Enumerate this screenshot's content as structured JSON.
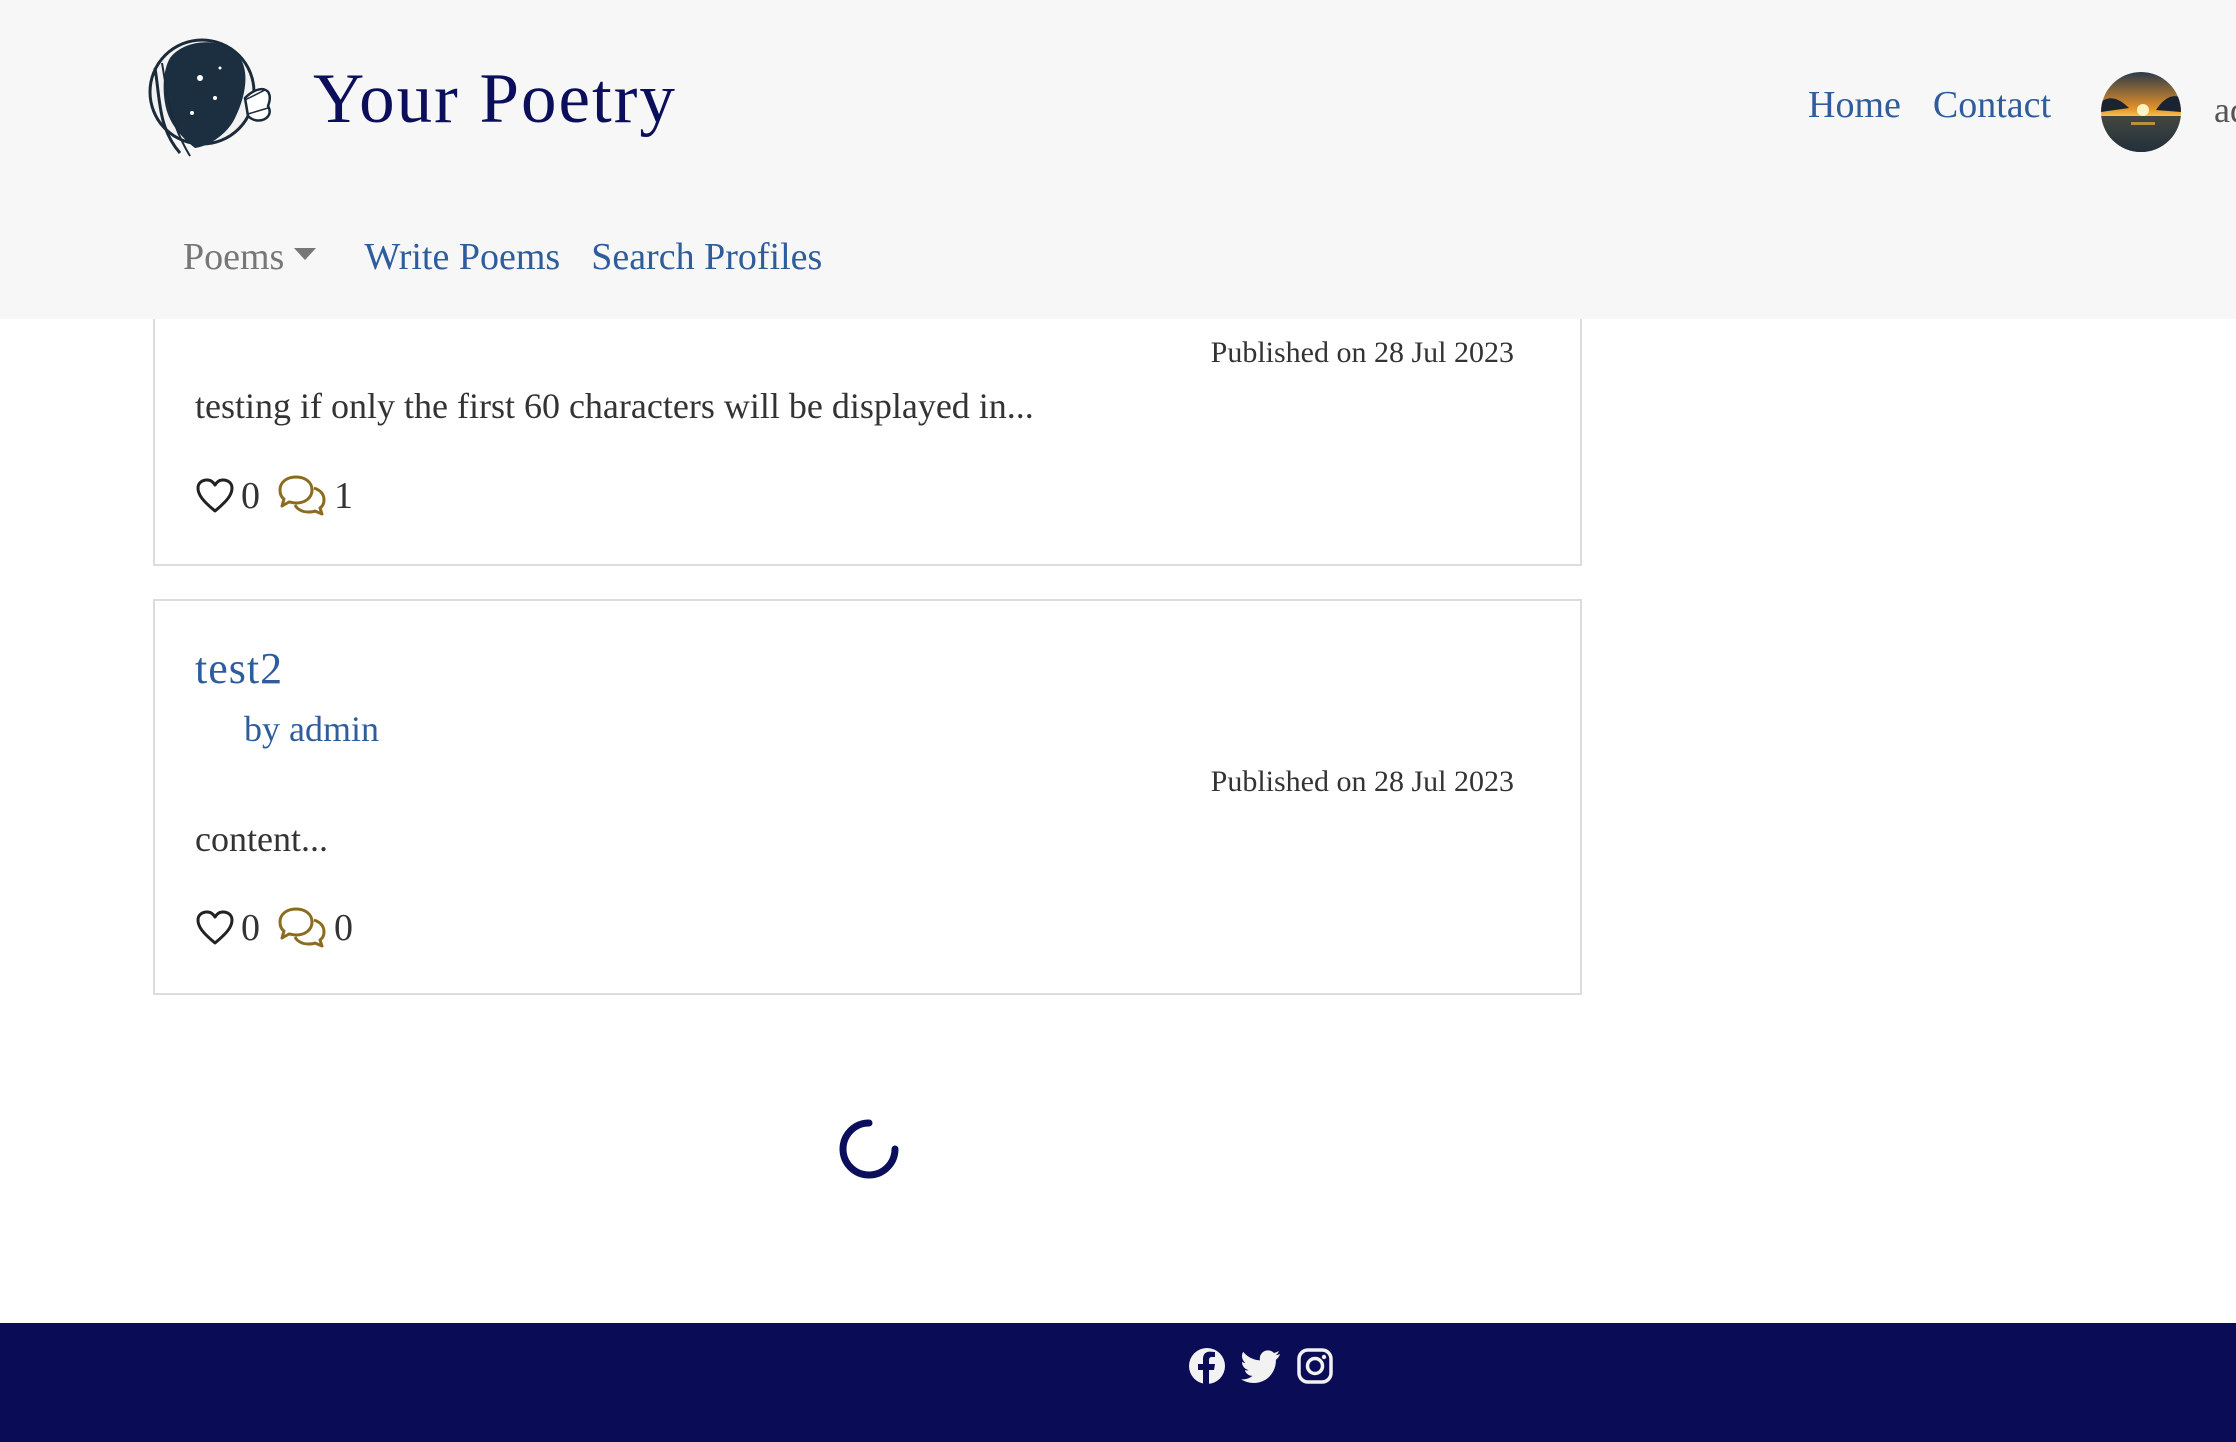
{
  "brand": {
    "name": "Your Poetry",
    "logo_icon": "woman-profile-butterfly-logo"
  },
  "nav": {
    "home": "Home",
    "contact": "Contact",
    "avatar_icon": "sunset-avatar",
    "user_name": "admin"
  },
  "subnav": {
    "poems": "Poems",
    "write": "Write Poems",
    "search": "Search Profiles"
  },
  "poems": [
    {
      "published": "Published on 28 Jul 2023",
      "excerpt": "testing if only the first 60 characters will be displayed in...",
      "likes": "0",
      "comments": "1"
    },
    {
      "title": "test2",
      "author": "by admin",
      "published": "Published on 28 Jul 2023",
      "excerpt": "content...",
      "likes": "0",
      "comments": "0"
    }
  ],
  "colors": {
    "brand": "#0b0e5a",
    "link": "#2f5d9c",
    "footer": "#0a0c55",
    "comment_icon": "#8b6b1e"
  },
  "footer": {
    "icons": [
      "facebook-icon",
      "twitter-icon",
      "instagram-icon"
    ]
  }
}
